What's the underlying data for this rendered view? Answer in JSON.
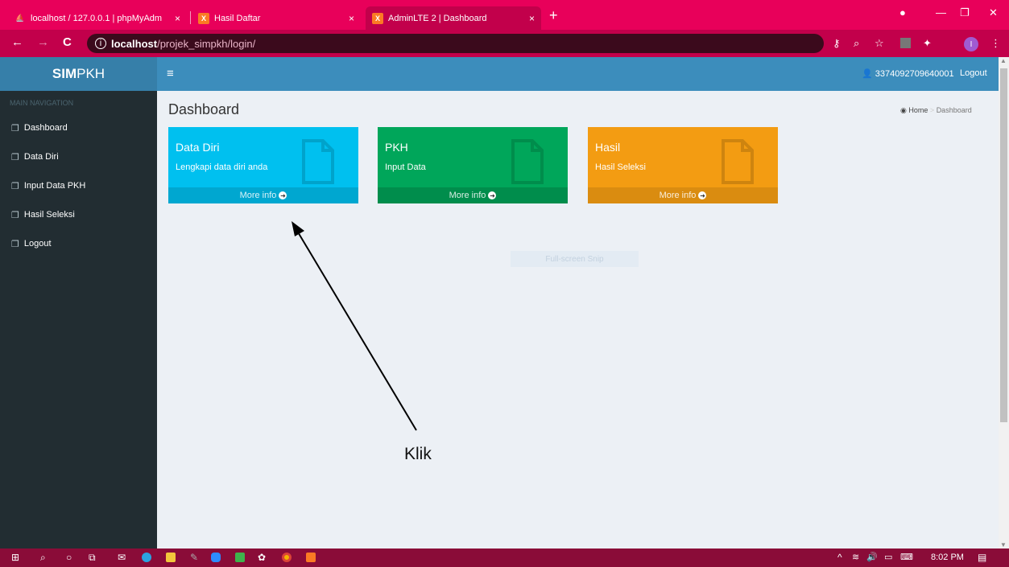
{
  "browser": {
    "tabs": [
      {
        "label": "localhost / 127.0.0.1 | phpMyAdm",
        "favicon": "phpmyadmin-icon",
        "close": "×"
      },
      {
        "label": "Hasil Daftar",
        "favicon": "xampp-icon",
        "close": "×"
      },
      {
        "label": "AdminLTE 2 | Dashboard",
        "favicon": "xampp-icon",
        "close": "×"
      }
    ],
    "new_tab": "+",
    "url_host": "localhost",
    "url_path": "/projek_simpkh/login/",
    "profile_initial": "I",
    "accent_color": "#e8005a"
  },
  "app": {
    "logo_bold": "SIM",
    "logo_rest": "PKH",
    "user_id": "3374092709640001",
    "logout": "Logout"
  },
  "sidebar": {
    "header": "MAIN NAVIGATION",
    "items": [
      {
        "label": "Dashboard"
      },
      {
        "label": "Data Diri"
      },
      {
        "label": "Input Data PKH"
      },
      {
        "label": "Hasil Seleksi"
      },
      {
        "label": "Logout"
      }
    ]
  },
  "content": {
    "title": "Dashboard",
    "breadcrumb_home": "Home",
    "breadcrumb_current": "Dashboard",
    "boxes": [
      {
        "title": "Data Diri",
        "subtitle": "Lengkapi data diri anda",
        "footer": "More info",
        "color": "#00c0ef"
      },
      {
        "title": "PKH",
        "subtitle": "Input Data",
        "footer": "More info",
        "color": "#00a65a"
      },
      {
        "title": "Hasil",
        "subtitle": "Hasil Seleksi",
        "footer": "More info",
        "color": "#f39c12"
      }
    ],
    "snip_overlay": "Full-screen Snip",
    "annotation": "Klik"
  },
  "taskbar": {
    "time": "8:02 PM"
  }
}
